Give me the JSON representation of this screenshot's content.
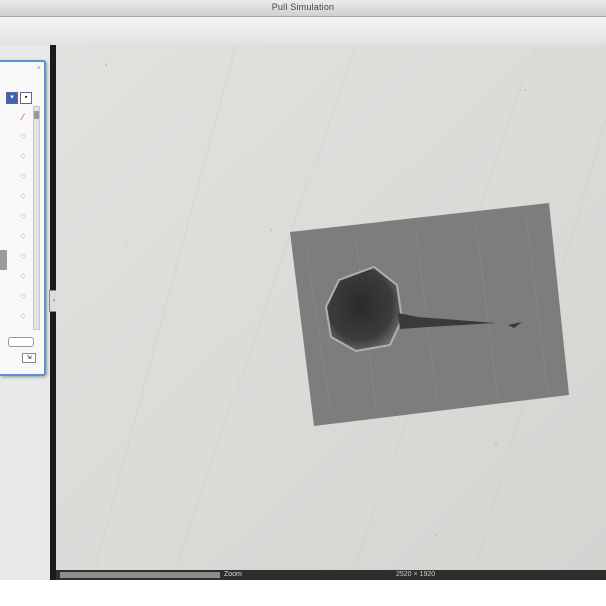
{
  "window": {
    "title": "Pull Simulation"
  },
  "palette": {
    "tabs": [
      "▾",
      "▪"
    ],
    "items": [
      "⁄",
      "◇",
      "◇",
      "◇",
      "◇",
      "◇",
      "◇",
      "◇",
      "◇",
      "◇",
      "◇"
    ],
    "close_glyph": "×",
    "small_btn": "⇲"
  },
  "splitter": {
    "glyph": "‹"
  },
  "status": {
    "zoom": "Zoom",
    "info": "2520 × 1920"
  }
}
